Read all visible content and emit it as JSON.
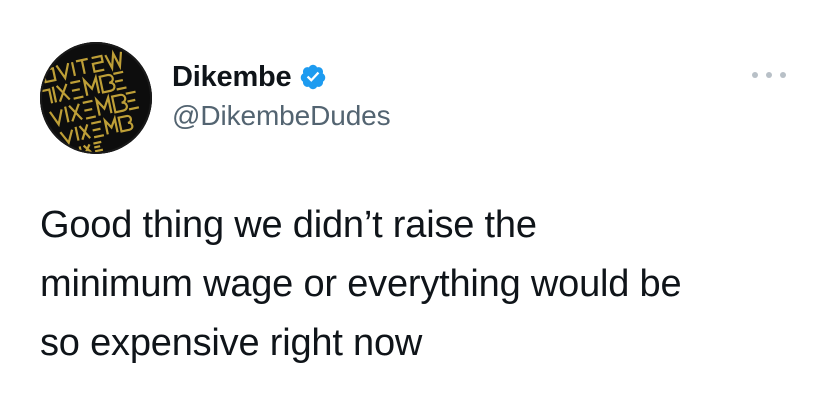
{
  "author": {
    "display_name": "Dikembe",
    "handle": "@DikembeDudes",
    "verified": true,
    "avatar_icon": "gold-lettering-avatar-icon",
    "avatar_colors": {
      "background": "#0d0d0d",
      "lettering": "#c9a83a"
    }
  },
  "menu": {
    "icon": "more-options-icon"
  },
  "tweet": {
    "lines": [
      "Good thing we didn’t raise the",
      "minimum wage or everything would be",
      "so expensive right now"
    ]
  },
  "colors": {
    "verified_badge": "#1d9bf0",
    "text": "#0f1419",
    "handle": "#536471",
    "menu_dots": "#b8c0c7"
  }
}
